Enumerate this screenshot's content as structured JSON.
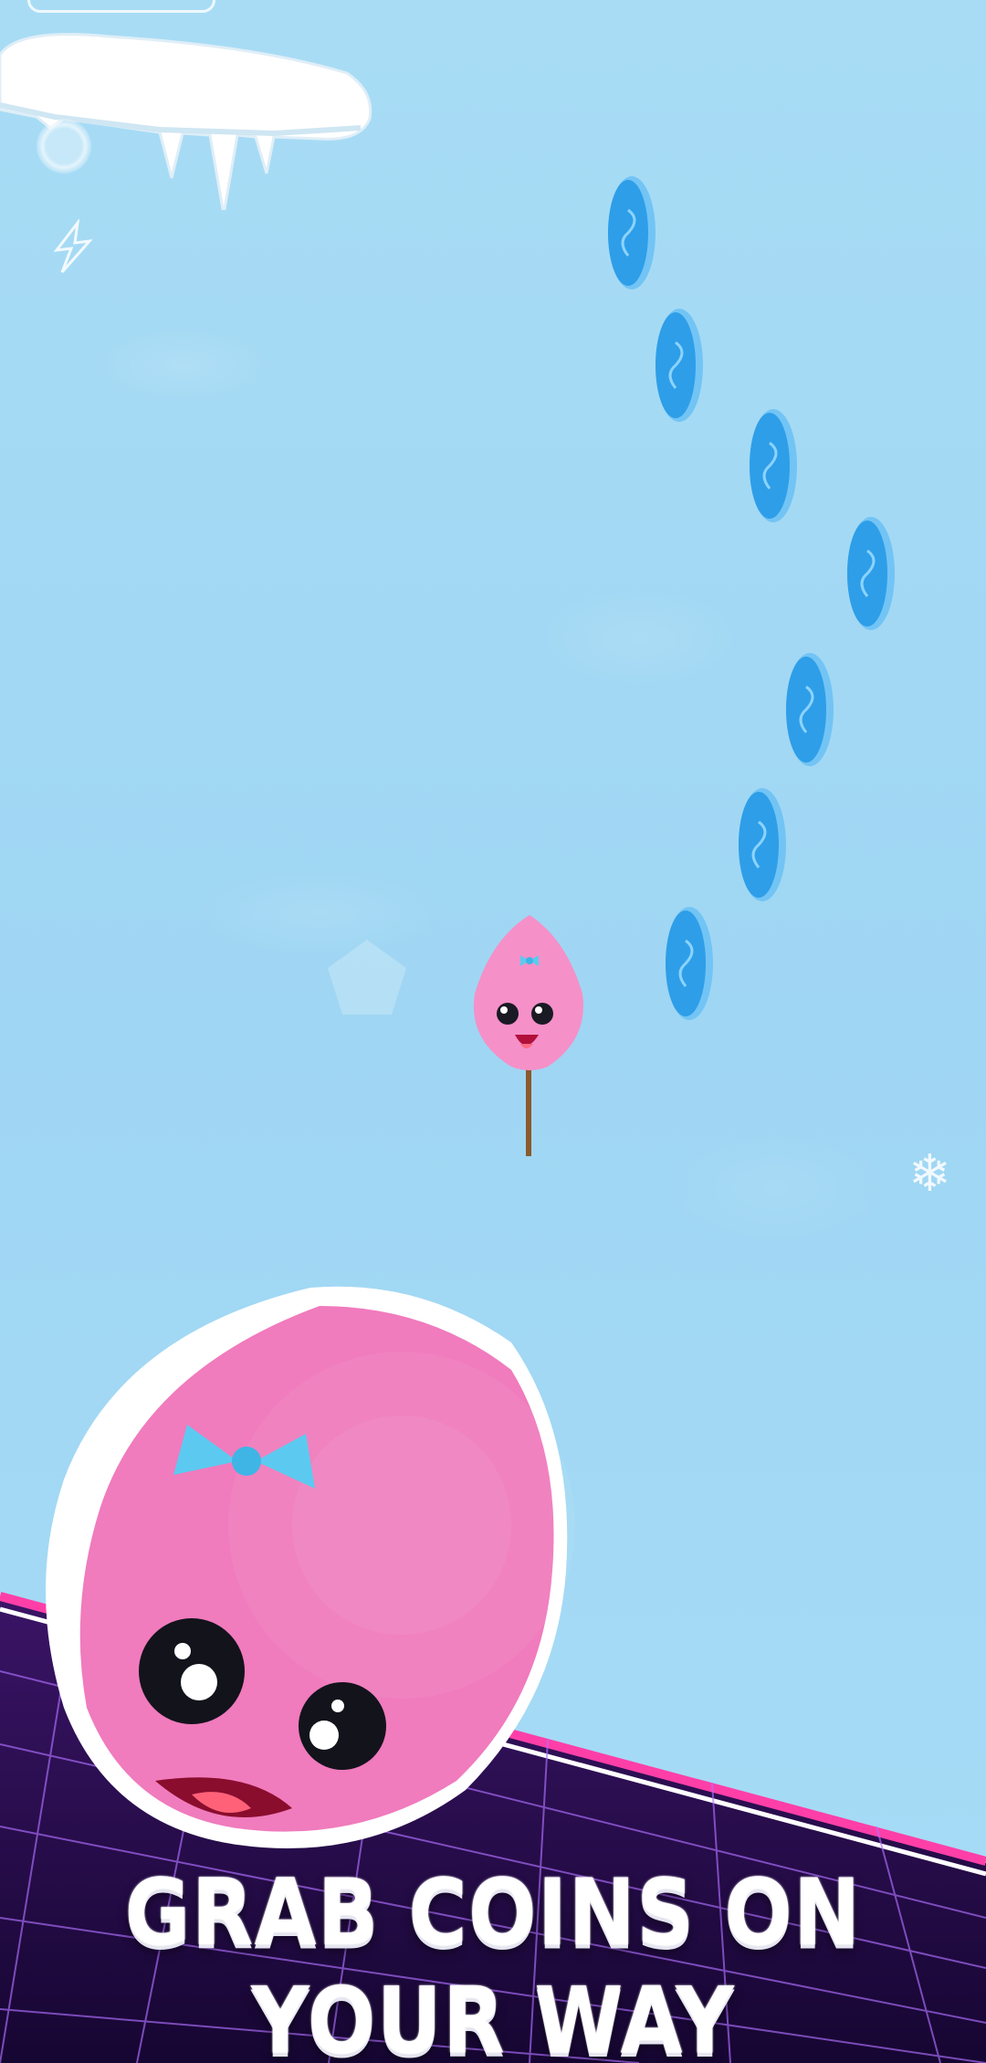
{
  "caption": "GRAB COINS ON YOUR WAY",
  "colors": {
    "sky": "#a8dcf5",
    "coin_face": "#2e9ee8",
    "coin_edge": "#72c4f5",
    "candy_pink": "#f07bbd",
    "bow_blue": "#5ccaf0",
    "floor_purple": "#2b0c4d",
    "floor_edge": "#ff3fa8"
  },
  "icons": {
    "powerup": "ring-icon",
    "boost": "lightning-icon",
    "shape": "pentagon-icon",
    "weather": "snowflake-icon"
  },
  "coins_count": 7
}
